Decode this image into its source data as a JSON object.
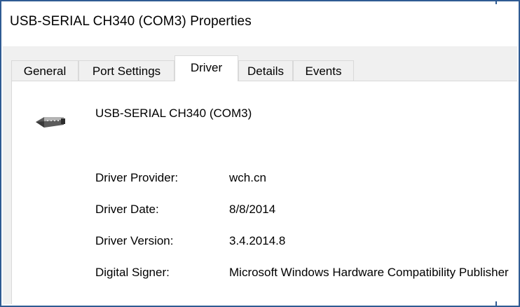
{
  "window": {
    "title": "USB-SERIAL CH340 (COM3) Properties"
  },
  "tabs": [
    {
      "label": "General",
      "active": false
    },
    {
      "label": "Port Settings",
      "active": false
    },
    {
      "label": "Driver",
      "active": true
    },
    {
      "label": "Details",
      "active": false
    },
    {
      "label": "Events",
      "active": false
    }
  ],
  "device": {
    "icon": "serial-port-icon",
    "name": "USB-SERIAL CH340 (COM3)"
  },
  "driver_info": [
    {
      "label": "Driver Provider:",
      "value": "wch.cn"
    },
    {
      "label": "Driver Date:",
      "value": "8/8/2014"
    },
    {
      "label": "Driver Version:",
      "value": "3.4.2014.8"
    },
    {
      "label": "Digital Signer:",
      "value": "Microsoft Windows Hardware Compatibility Publisher"
    }
  ],
  "colors": {
    "frame_border": "#2f5b93",
    "dialog_background": "#f0f0f0",
    "panel_background": "#ffffff",
    "tab_border": "#d9d9d9"
  }
}
